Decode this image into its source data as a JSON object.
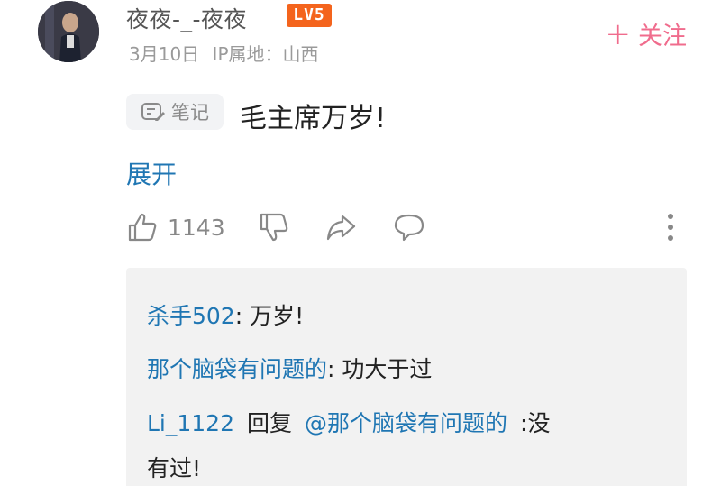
{
  "header": {
    "username": "夜夜-_-夜夜",
    "level_badge": "LV5",
    "date": "3月10日",
    "ip_location": "IP属地：山西",
    "follow_label": "关注",
    "follow_icon": "plus-icon"
  },
  "comment": {
    "note_label": "笔记",
    "note_icon": "note-edit-icon",
    "text": "毛主席万岁!",
    "expand_label": "展开"
  },
  "actions": {
    "like_count": "1143",
    "icons": [
      "thumbs-up-icon",
      "thumbs-down-icon",
      "share-icon",
      "comment-icon",
      "more-vertical-icon"
    ]
  },
  "replies": [
    {
      "author": "杀手502",
      "separator": ":",
      "text": "万岁!"
    },
    {
      "author": "那个脑袋有问题的",
      "separator": ":",
      "text": "功大于过"
    },
    {
      "author": "Li_1122",
      "reply_word": "回复",
      "mention": "@那个脑袋有问题的",
      "separator": ":",
      "text_line1": "没",
      "text_line2": "有过!"
    }
  ],
  "colors": {
    "link_blue": "#1f76b3",
    "follow_pink": "#f06c8d",
    "badge_orange": "#f4641d",
    "panel_bg": "#f2f2f2"
  }
}
